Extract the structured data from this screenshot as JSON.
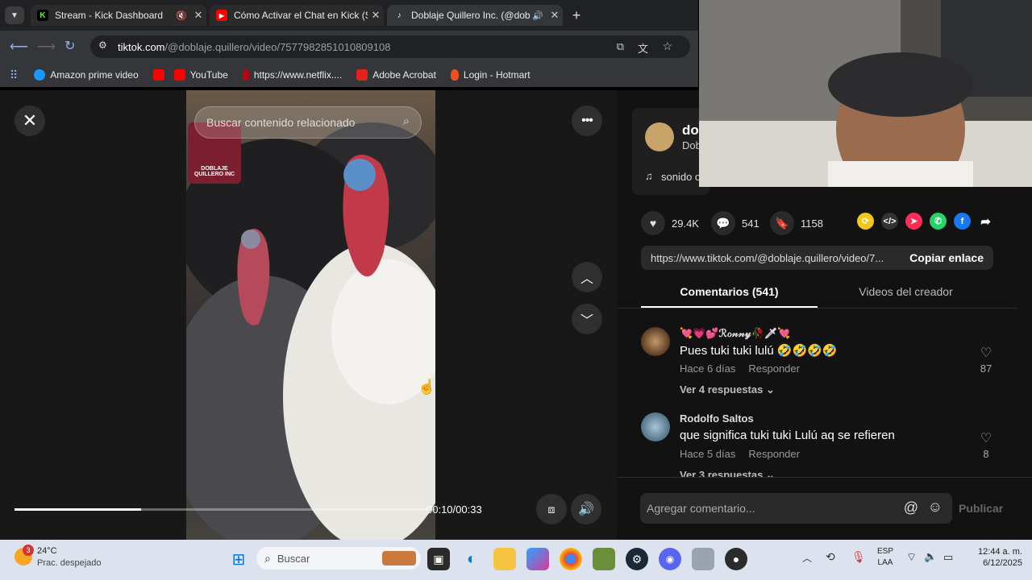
{
  "browser": {
    "tabs": [
      {
        "title": "Stream - Kick Dashboard",
        "color": "#53fc18",
        "icon": "kick-icon",
        "glyph": "K"
      },
      {
        "title": "Cómo Activar el Chat en Kick (S",
        "color": "#ff0000",
        "icon": "youtube-icon",
        "glyph": "▶"
      },
      {
        "title": "Doblaje Quillero Inc. (@dob",
        "color": "#ffffff",
        "icon": "tiktok-icon",
        "glyph": "♪"
      }
    ],
    "url_host": "tiktok.com",
    "url_path": "/@doblaje.quillero/video/7577982851010809108",
    "bookmarks": [
      "Amazon prime video",
      "YouTube",
      "https://www.netflix....",
      "Adobe Acrobat",
      "Login - Hotmart"
    ]
  },
  "video": {
    "search_placeholder": "Buscar contenido relacionado",
    "watermark": "DOBLAJE QUILLERO INC",
    "time": "00:10/00:33",
    "progress": 0.3
  },
  "creator": {
    "handle_partial": "dob",
    "name_partial": "Dob",
    "sound_partial": "sonido o"
  },
  "stats": {
    "likes": "29.4K",
    "comments": "541",
    "saves": "1158"
  },
  "link": {
    "url": "https://www.tiktok.com/@doblaje.quillero/video/7...",
    "copy_label": "Copiar enlace"
  },
  "tabs": {
    "comments": "Comentarios (541)",
    "creator_videos": "Videos del creador"
  },
  "comments": [
    {
      "name": "💘💗💕ℛℴ𝓃𝓃𝓎🥀🗡💘",
      "text": "Pues tuki tuki lulú 🤣🤣🤣🤣",
      "time": "Hace 6 días",
      "reply": "Responder",
      "likes": "87",
      "replies": "Ver 4 respuestas"
    },
    {
      "name": "Rodolfo Saltos",
      "text": "que significa tuki tuki Lulú aq se refieren",
      "time": "Hace 5 días",
      "reply": "Responder",
      "likes": "8",
      "replies": "Ver 3 respuestas"
    }
  ],
  "composer": {
    "placeholder": "Agregar comentario...",
    "publish": "Publicar"
  },
  "taskbar": {
    "weather_temp": "24°C",
    "weather_desc": "Prac. despejado",
    "weather_badge": "3",
    "search_label": "Buscar",
    "lang1": "ESP",
    "lang2": "LAA",
    "time": "12:44 a. m.",
    "date": "6/12/2025"
  }
}
